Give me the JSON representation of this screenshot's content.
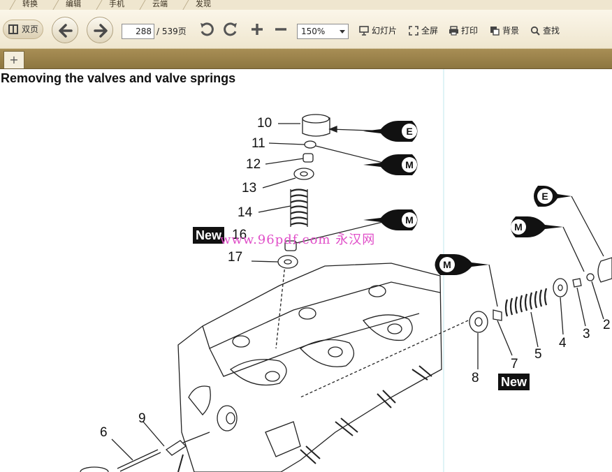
{
  "menu": {
    "tabs": [
      "转换",
      "编辑",
      "手机",
      "云端",
      "发现"
    ]
  },
  "toolbar": {
    "dual_page_label": "双页",
    "page_current": "288",
    "page_total": "/ 539页",
    "zoom": "150%",
    "slideshow_label": "幻灯片",
    "fullscreen_label": "全屏",
    "print_label": "打印",
    "background_label": "背景",
    "find_label": "查找"
  },
  "tabstrip": {
    "add_label": "+"
  },
  "document": {
    "title": "Removing the valves and valve springs",
    "watermark": "www.96pdf.com 永汉网",
    "callouts": {
      "c10": "10",
      "c11": "11",
      "c12": "12",
      "c13": "13",
      "c14": "14",
      "c16": "16",
      "c17": "17",
      "c9": "9",
      "c6": "6",
      "c8": "8",
      "c7": "7",
      "c5": "5",
      "c4": "4",
      "c3": "3",
      "c2": "2"
    },
    "new_label_1": "New",
    "new_label_2": "New",
    "symbols": {
      "e1": "E",
      "m1": "M",
      "m2": "M",
      "m3": "M",
      "e2": "E",
      "m4": "M"
    }
  },
  "colors": {
    "toolbar_bg": "#efe6cf",
    "tabstrip_bg": "#a88e55",
    "watermark": "#e04ec8"
  }
}
